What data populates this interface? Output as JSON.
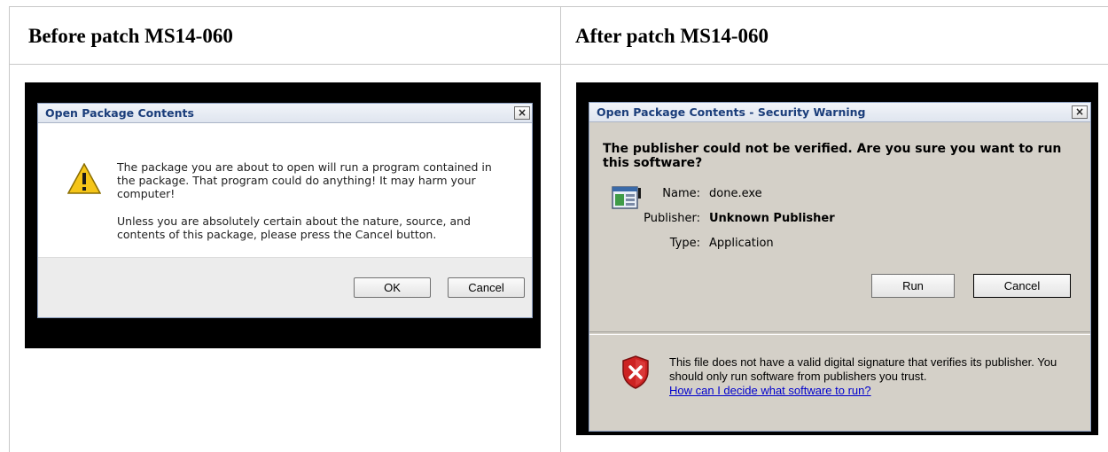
{
  "columns": {
    "before_heading": "Before patch MS14-060",
    "after_heading": "After patch MS14-060"
  },
  "before_dialog": {
    "title": "Open Package Contents",
    "close_glyph": "×",
    "icon": "warning-triangle-icon",
    "message_1": "The package you are about to open will run a program contained in the package. That program could do anything!  It may harm your computer!",
    "message_2": "Unless you are absolutely certain about the nature, source, and contents of this package, please press the Cancel button.",
    "ok_label": "OK",
    "cancel_label": "Cancel"
  },
  "after_dialog": {
    "title": "Open Package Contents - Security Warning",
    "close_glyph": "×",
    "question": "The publisher could not be verified.  Are you sure you want to run this software?",
    "file_icon": "application-icon",
    "name_label": "Name:",
    "name_value": "done.exe",
    "publisher_label": "Publisher:",
    "publisher_value": "Unknown Publisher",
    "type_label": "Type:",
    "type_value": "Application",
    "run_label": "Run",
    "cancel_label": "Cancel",
    "shield_icon": "security-shield-x-icon",
    "warning_text": "This file does not have a valid digital signature that verifies its publisher.  You should only run software from publishers you trust.",
    "help_link": "How can I decide what software to run?"
  },
  "colors": {
    "title_text": "#1a3d7a",
    "dialog_gray": "#d4d0c8",
    "link": "#0000cc",
    "shield_red": "#cc2222",
    "warning_yellow": "#f5c518"
  }
}
